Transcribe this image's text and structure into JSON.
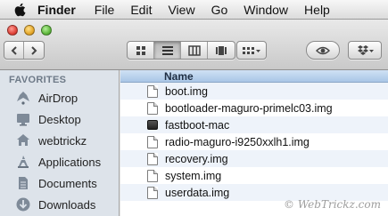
{
  "menubar": {
    "apple_icon": "apple-logo-icon",
    "app_name": "Finder",
    "items": [
      "File",
      "Edit",
      "View",
      "Go",
      "Window",
      "Help"
    ]
  },
  "toolbar": {
    "back_icon": "chevron-left-icon",
    "forward_icon": "chevron-right-icon",
    "views": [
      "icon-view-icon",
      "list-view-icon",
      "column-view-icon",
      "coverflow-view-icon"
    ],
    "active_view": "list-view-icon",
    "arrange_icon": "arrange-grid-icon",
    "quicklook_icon": "eye-icon",
    "dropbox_icon": "dropbox-icon"
  },
  "sidebar": {
    "header": "FAVORITES",
    "items": [
      {
        "label": "AirDrop",
        "icon": "airdrop-icon"
      },
      {
        "label": "Desktop",
        "icon": "desktop-icon"
      },
      {
        "label": "webtrickz",
        "icon": "home-icon"
      },
      {
        "label": "Applications",
        "icon": "applications-icon"
      },
      {
        "label": "Documents",
        "icon": "documents-icon"
      },
      {
        "label": "Downloads",
        "icon": "downloads-icon"
      }
    ]
  },
  "list": {
    "column_header": "Name",
    "files": [
      {
        "name": "boot.img",
        "kind": "document"
      },
      {
        "name": "bootloader-maguro-primelc03.img",
        "kind": "document"
      },
      {
        "name": "fastboot-mac",
        "kind": "executable"
      },
      {
        "name": "radio-maguro-i9250xxlh1.img",
        "kind": "document"
      },
      {
        "name": "recovery.img",
        "kind": "document"
      },
      {
        "name": "system.img",
        "kind": "document"
      },
      {
        "name": "userdata.img",
        "kind": "document"
      }
    ]
  },
  "watermark": "© WebTrickz.com",
  "colors": {
    "sidebar_bg": "#dde3ea",
    "header_blue": "#a9c6e6",
    "row_alt": "#eef3fa"
  }
}
